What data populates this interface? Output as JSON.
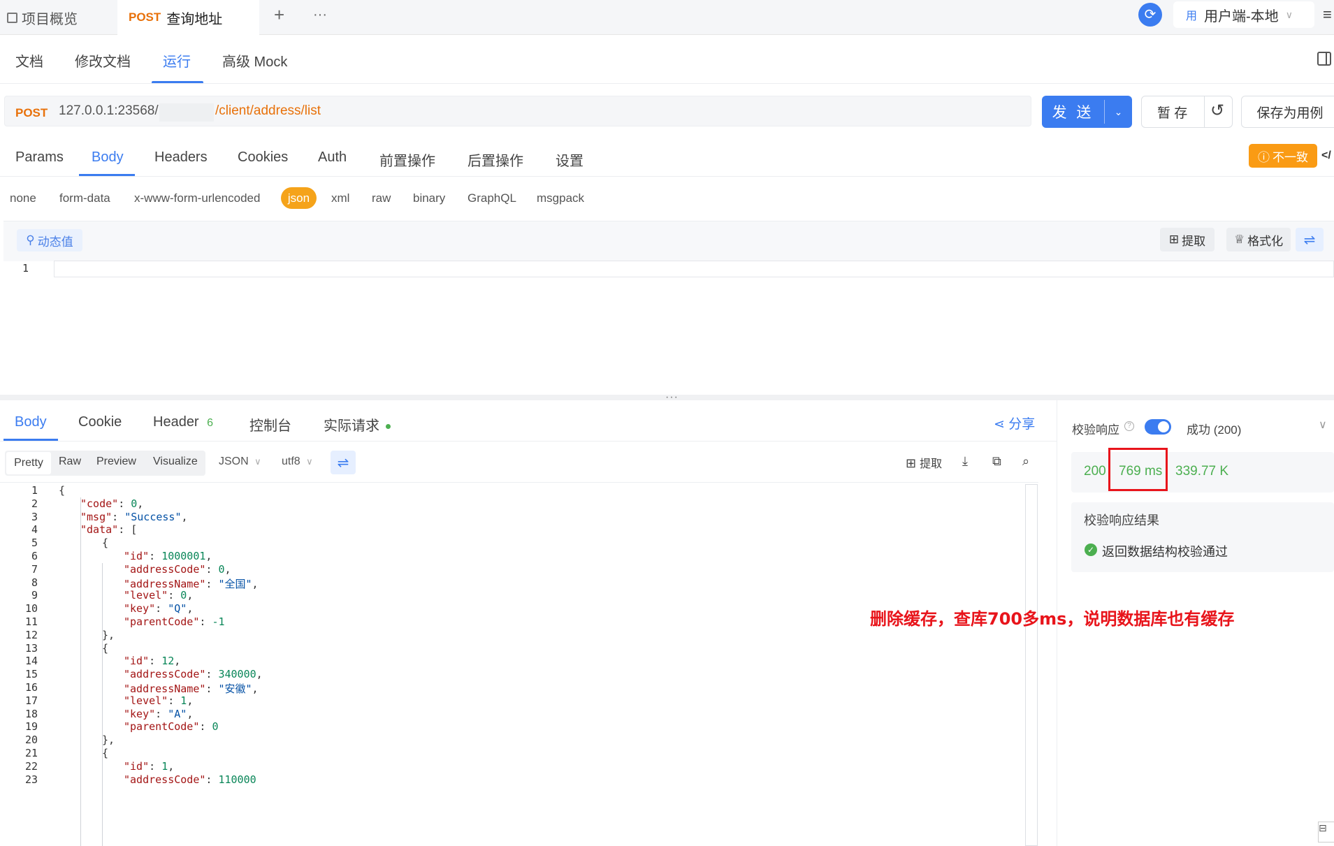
{
  "top_tabs": {
    "overview": "项目概览",
    "request_method": "POST",
    "request_name": "查询地址",
    "add": "+",
    "more": "···",
    "environment": "用户端-本地",
    "env_badge": "用"
  },
  "subnav": [
    "文档",
    "修改文档",
    "运行",
    "高级 Mock"
  ],
  "url": {
    "method": "POST",
    "host": "127.0.0.1:23568/",
    "path": "/client/address/list"
  },
  "actions": {
    "send": "发 送",
    "draft": "暂 存",
    "save_as_case": "保存为用例"
  },
  "request_tabs": [
    "Params",
    "Body",
    "Headers",
    "Cookies",
    "Auth",
    "前置操作",
    "后置操作",
    "设置"
  ],
  "inconsistent_badge": "不一致",
  "body_types": [
    "none",
    "form-data",
    "x-www-form-urlencoded",
    "json",
    "xml",
    "raw",
    "binary",
    "GraphQL",
    "msgpack"
  ],
  "editor": {
    "dynamic_value": "动态值",
    "extract": "提取",
    "format": "格式化",
    "line_number": "1"
  },
  "response_tabs": {
    "body": "Body",
    "cookie": "Cookie",
    "header": "Header",
    "header_count": "6",
    "console": "控制台",
    "actual_request": "实际请求"
  },
  "share": "分享",
  "view_modes": [
    "Pretty",
    "Raw",
    "Preview",
    "Visualize"
  ],
  "format_dropdown": "JSON",
  "encoding_dropdown": "utf8",
  "response_tools": {
    "extract": "提取"
  },
  "code_lines": [
    {
      "n": "1",
      "indent": 0,
      "parts": [
        [
          "p",
          "{"
        ]
      ]
    },
    {
      "n": "2",
      "indent": 1,
      "parts": [
        [
          "k",
          "\"code\""
        ],
        [
          "p",
          ": "
        ],
        [
          "n",
          "0"
        ],
        [
          "p",
          ","
        ]
      ]
    },
    {
      "n": "3",
      "indent": 1,
      "parts": [
        [
          "k",
          "\"msg\""
        ],
        [
          "p",
          ": "
        ],
        [
          "s",
          "\"Success\""
        ],
        [
          "p",
          ","
        ]
      ]
    },
    {
      "n": "4",
      "indent": 1,
      "parts": [
        [
          "k",
          "\"data\""
        ],
        [
          "p",
          ": ["
        ]
      ]
    },
    {
      "n": "5",
      "indent": 2,
      "parts": [
        [
          "p",
          "{"
        ]
      ]
    },
    {
      "n": "6",
      "indent": 3,
      "parts": [
        [
          "k",
          "\"id\""
        ],
        [
          "p",
          ": "
        ],
        [
          "n",
          "1000001"
        ],
        [
          "p",
          ","
        ]
      ]
    },
    {
      "n": "7",
      "indent": 3,
      "parts": [
        [
          "k",
          "\"addressCode\""
        ],
        [
          "p",
          ": "
        ],
        [
          "n",
          "0"
        ],
        [
          "p",
          ","
        ]
      ]
    },
    {
      "n": "8",
      "indent": 3,
      "parts": [
        [
          "k",
          "\"addressName\""
        ],
        [
          "p",
          ": "
        ],
        [
          "s",
          "\"全国\""
        ],
        [
          "p",
          ","
        ]
      ]
    },
    {
      "n": "9",
      "indent": 3,
      "parts": [
        [
          "k",
          "\"level\""
        ],
        [
          "p",
          ": "
        ],
        [
          "n",
          "0"
        ],
        [
          "p",
          ","
        ]
      ]
    },
    {
      "n": "10",
      "indent": 3,
      "parts": [
        [
          "k",
          "\"key\""
        ],
        [
          "p",
          ": "
        ],
        [
          "s",
          "\"Q\""
        ],
        [
          "p",
          ","
        ]
      ]
    },
    {
      "n": "11",
      "indent": 3,
      "parts": [
        [
          "k",
          "\"parentCode\""
        ],
        [
          "p",
          ": "
        ],
        [
          "n",
          "-1"
        ]
      ]
    },
    {
      "n": "12",
      "indent": 2,
      "parts": [
        [
          "p",
          "},"
        ]
      ]
    },
    {
      "n": "13",
      "indent": 2,
      "parts": [
        [
          "p",
          "{"
        ]
      ]
    },
    {
      "n": "14",
      "indent": 3,
      "parts": [
        [
          "k",
          "\"id\""
        ],
        [
          "p",
          ": "
        ],
        [
          "n",
          "12"
        ],
        [
          "p",
          ","
        ]
      ]
    },
    {
      "n": "15",
      "indent": 3,
      "parts": [
        [
          "k",
          "\"addressCode\""
        ],
        [
          "p",
          ": "
        ],
        [
          "n",
          "340000"
        ],
        [
          "p",
          ","
        ]
      ]
    },
    {
      "n": "16",
      "indent": 3,
      "parts": [
        [
          "k",
          "\"addressName\""
        ],
        [
          "p",
          ": "
        ],
        [
          "s",
          "\"安徽\""
        ],
        [
          "p",
          ","
        ]
      ]
    },
    {
      "n": "17",
      "indent": 3,
      "parts": [
        [
          "k",
          "\"level\""
        ],
        [
          "p",
          ": "
        ],
        [
          "n",
          "1"
        ],
        [
          "p",
          ","
        ]
      ]
    },
    {
      "n": "18",
      "indent": 3,
      "parts": [
        [
          "k",
          "\"key\""
        ],
        [
          "p",
          ": "
        ],
        [
          "s",
          "\"A\""
        ],
        [
          "p",
          ","
        ]
      ]
    },
    {
      "n": "19",
      "indent": 3,
      "parts": [
        [
          "k",
          "\"parentCode\""
        ],
        [
          "p",
          ": "
        ],
        [
          "n",
          "0"
        ]
      ]
    },
    {
      "n": "20",
      "indent": 2,
      "parts": [
        [
          "p",
          "},"
        ]
      ]
    },
    {
      "n": "21",
      "indent": 2,
      "parts": [
        [
          "p",
          "{"
        ]
      ]
    },
    {
      "n": "22",
      "indent": 3,
      "parts": [
        [
          "k",
          "\"id\""
        ],
        [
          "p",
          ": "
        ],
        [
          "n",
          "1"
        ],
        [
          "p",
          ","
        ]
      ]
    },
    {
      "n": "23",
      "indent": 3,
      "parts": [
        [
          "k",
          "\"addressCode\""
        ],
        [
          "p",
          ": "
        ],
        [
          "n",
          "110000"
        ]
      ]
    }
  ],
  "validation": {
    "title": "校验响应",
    "enabled": true,
    "status": "成功 (200)",
    "status_code": "200",
    "time": "769 ms",
    "size": "339.77 K",
    "result_title": "校验响应结果",
    "result": "返回数据结构校验通过"
  },
  "annotation": "删除缓存，查库700多ms，说明数据库也有缓存",
  "colors": {
    "accent": "#3b7cf0",
    "method": "#e8710a",
    "json_pill": "#f5a31a",
    "success": "#4caf50",
    "highlight": "#e8141b"
  }
}
